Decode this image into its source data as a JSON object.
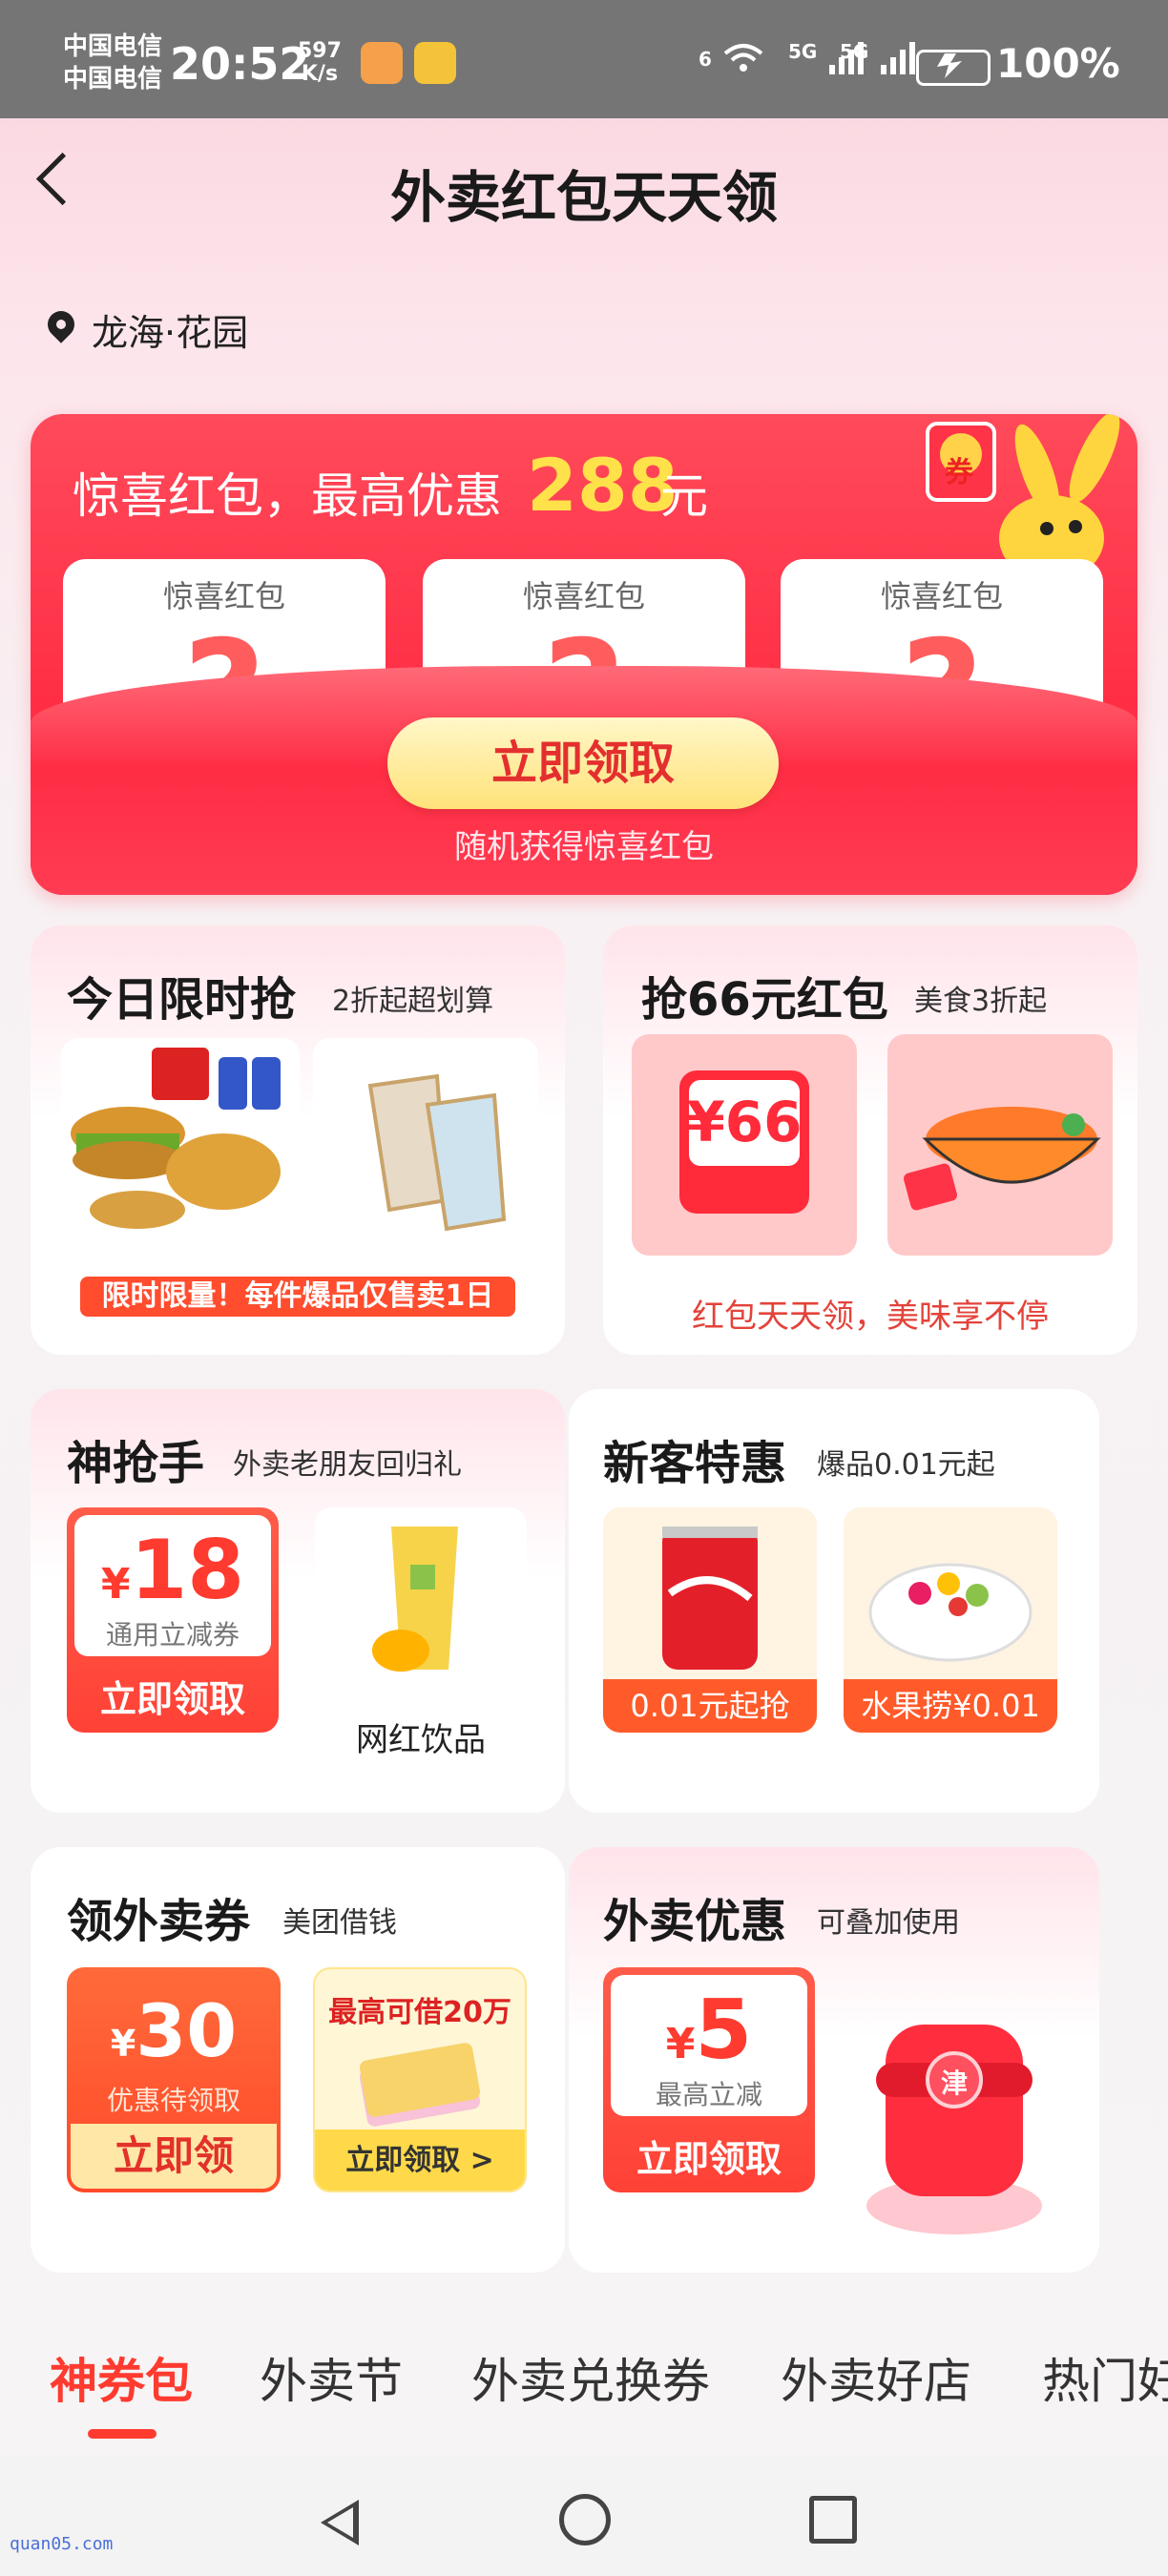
{
  "status_bar": {
    "carrier_1": "中国电信",
    "carrier_2": "中国电信",
    "time": "20:52",
    "net_speed_value": "597",
    "net_speed_unit": "K/s",
    "signal_1": "5G",
    "signal_2": "5G",
    "wifi_label": "6",
    "battery": "100%"
  },
  "header": {
    "title": "外卖红包天天领",
    "location": "龙海·花园"
  },
  "surprise": {
    "title": "惊喜红包，最高优惠",
    "amount": "288",
    "unit": "元",
    "mascot_badge": "券",
    "packets": [
      {
        "label": "惊喜红包",
        "mark": "?"
      },
      {
        "label": "惊喜红包",
        "mark": "?"
      },
      {
        "label": "惊喜红包",
        "mark": "?"
      }
    ],
    "button": "立即领取",
    "subtitle": "随机获得惊喜红包"
  },
  "cards": {
    "flash": {
      "title": "今日限时抢",
      "sub": "2折起超划算",
      "banner": "限时限量！每件爆品仅售卖1日"
    },
    "red66": {
      "title": "抢66元红包",
      "sub": "美食3折起",
      "packet_text": "¥66",
      "footer": "红包天天领，美味享不停"
    },
    "sniper": {
      "title": "神抢手",
      "sub": "外卖老朋友回归礼",
      "coupon_amount": "18",
      "coupon_currency": "¥",
      "coupon_desc": "通用立减券",
      "coupon_button": "立即领取",
      "drink_label": "网红饮品"
    },
    "newbie": {
      "title": "新客特惠",
      "sub": "爆品0.01元起",
      "strip_1": "0.01元起抢",
      "strip_2": "水果捞¥0.01"
    },
    "voucher": {
      "title": "领外卖券",
      "sub": "美团借钱",
      "v_currency": "¥",
      "v_amount": "30",
      "v_desc": "优惠待领取",
      "v_button": "立即领",
      "loan_title": "最高可借20万",
      "loan_button": "立即领取 >"
    },
    "discount": {
      "title": "外卖优惠",
      "sub": "可叠加使用",
      "coupon_currency": "¥",
      "coupon_amount": "5",
      "coupon_desc": "最高立减",
      "coupon_button": "立即领取",
      "box_badge": "津"
    }
  },
  "tabs": [
    "神券包",
    "外卖节",
    "外卖兑换券",
    "外卖好店",
    "热门好"
  ],
  "watermark": "quan05.com",
  "colors": {
    "accent": "#ff3b30",
    "gold": "#ffe14a"
  }
}
